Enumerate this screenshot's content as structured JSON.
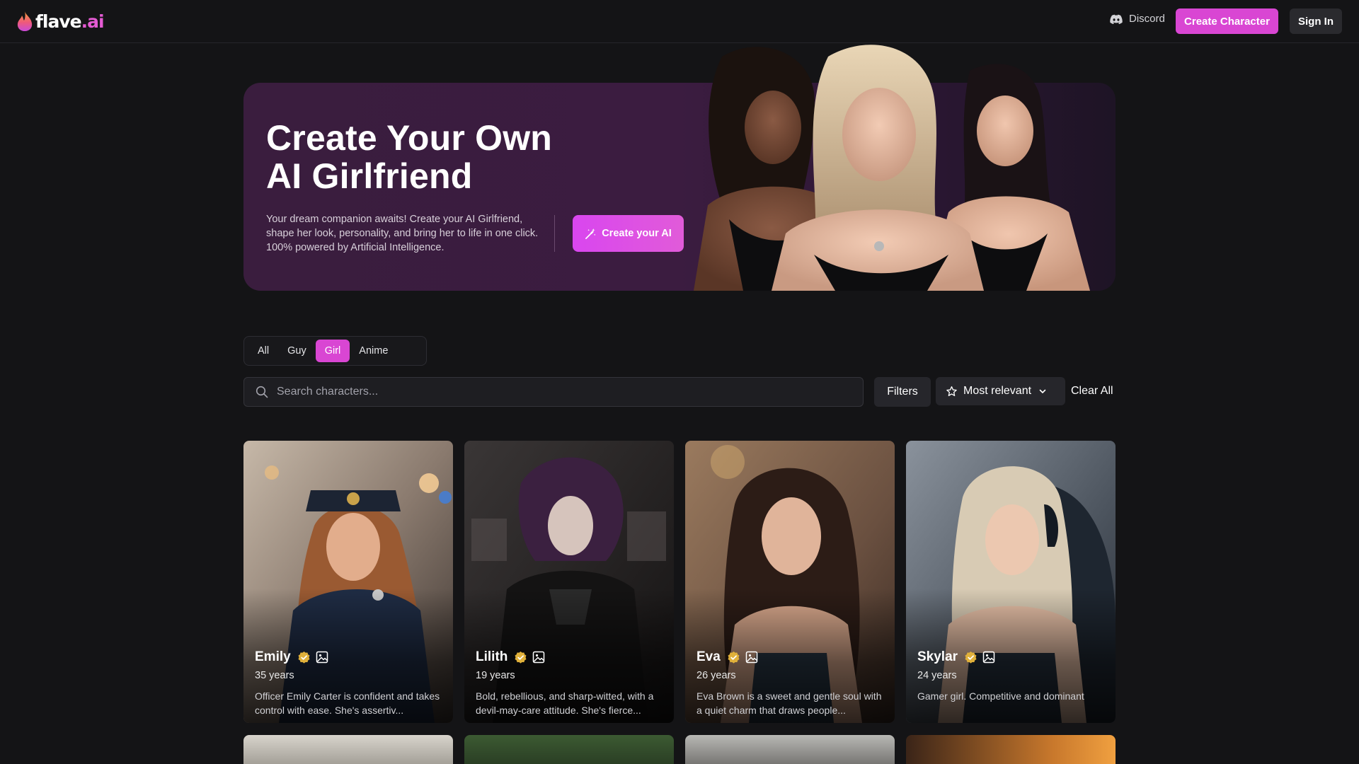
{
  "header": {
    "logo_main": "flave",
    "logo_ai": ".ai",
    "discord_label": "Discord",
    "create_character_label": "Create Character",
    "sign_in_label": "Sign In"
  },
  "hero": {
    "title_line1": "Create Your Own",
    "title_line2": "AI Girlfriend",
    "description": "Your dream companion awaits! Create your AI Girlfriend, shape her look, personality, and bring her to life in one click. 100% powered by Artificial Intelligence.",
    "cta_label": "Create your AI"
  },
  "tabs": [
    {
      "label": "All",
      "active": false
    },
    {
      "label": "Guy",
      "active": false
    },
    {
      "label": "Girl",
      "active": true
    },
    {
      "label": "Anime",
      "active": false
    }
  ],
  "search": {
    "placeholder": "Search characters...",
    "value": ""
  },
  "filters_label": "Filters",
  "sort_label": "Most relevant",
  "clear_all_label": "Clear All",
  "characters": [
    {
      "name": "Emily",
      "age": "35 years",
      "description": "Officer Emily Carter is confident and takes control with ease. She's assertiv..."
    },
    {
      "name": "Lilith",
      "age": "19 years",
      "description": "Bold, rebellious, and sharp-witted, with a devil-may-care attitude. She's fierce..."
    },
    {
      "name": "Eva",
      "age": "26 years",
      "description": "Eva Brown is a sweet and gentle soul with a quiet charm that draws people..."
    },
    {
      "name": "Skylar",
      "age": "24 years",
      "description": "Gamer girl. Competitive and dominant"
    }
  ],
  "colors": {
    "accent": "#d946d3",
    "background": "#141416",
    "hero_background": "#3a1d3e",
    "verified_badge": "#e0b03a"
  },
  "icons": {
    "logo": "flame-icon",
    "discord": "discord-icon",
    "create_ai": "magic-wand-icon",
    "search": "search-icon",
    "sort": "star-icon",
    "sort_open": "chevron-down-icon",
    "verified": "verified-badge-icon",
    "gallery": "image-icon"
  }
}
